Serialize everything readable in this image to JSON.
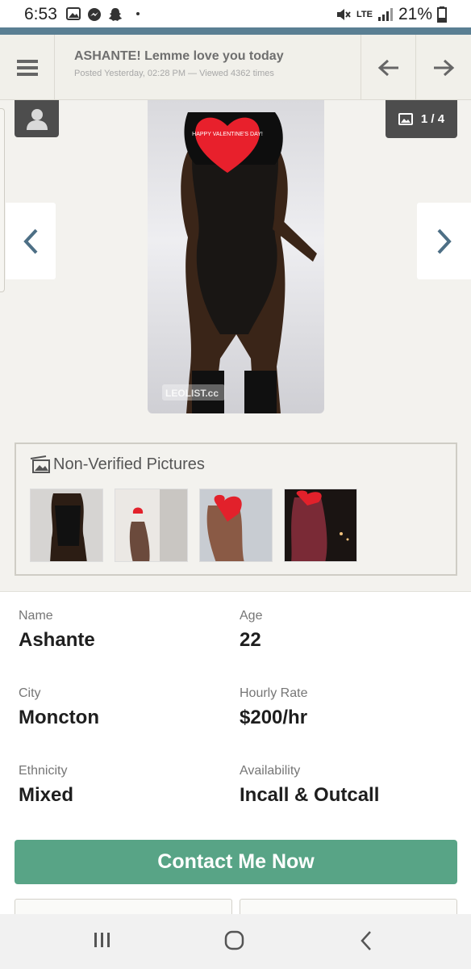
{
  "status_bar": {
    "time": "6:53",
    "network": "LTE",
    "battery": "21%"
  },
  "header": {
    "title": "ASHANTE! Lemme love you today",
    "subtitle": "Posted Yesterday, 02:28 PM — Viewed 4362 times"
  },
  "gallery": {
    "counter": "1 / 4",
    "watermark": "LEOLIST.cc",
    "sticker_text": "HAPPY VALENTINE'S DAY!"
  },
  "non_verified": {
    "title": "Non-Verified Pictures",
    "thumbnail_count": 4
  },
  "details": {
    "name_label": "Name",
    "name": "Ashante",
    "age_label": "Age",
    "age": "22",
    "city_label": "City",
    "city": "Moncton",
    "rate_label": "Hourly Rate",
    "rate": "$200/hr",
    "ethnicity_label": "Ethnicity",
    "ethnicity": "Mixed",
    "availability_label": "Availability",
    "availability": "Incall & Outcall"
  },
  "contact_button": "Contact Me Now",
  "colors": {
    "accent_strip": "#5a7f93",
    "contact_green": "#58a486",
    "arrow_blue": "#4d6f85"
  }
}
